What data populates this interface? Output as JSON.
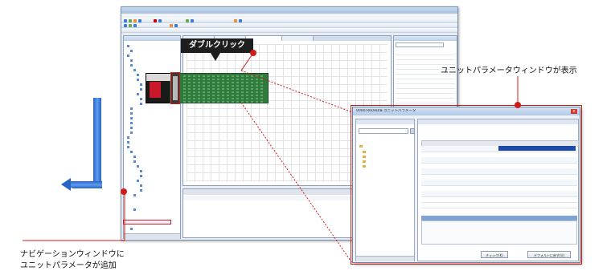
{
  "callouts": {
    "double_click": "ダブルクリック",
    "param_window_shown": "ユニットパラメータウィンドウが表示",
    "nav_added_line1": "ナビゲーションウィンドウに",
    "nav_added_line2": "ユニットパラメータが追加"
  },
  "parameter_window": {
    "title": "0000:R60ADI8 ユニットパラメータ",
    "buttons": {
      "check": "チェック(K)",
      "restore_default": "デフォルトに戻す(U)"
    }
  },
  "colors": {
    "highlight_red": "#d01b1b",
    "arrow_blue": "#2a64c4",
    "label_bg": "#1e1e1e",
    "rack_green": "#2f7b3c"
  }
}
